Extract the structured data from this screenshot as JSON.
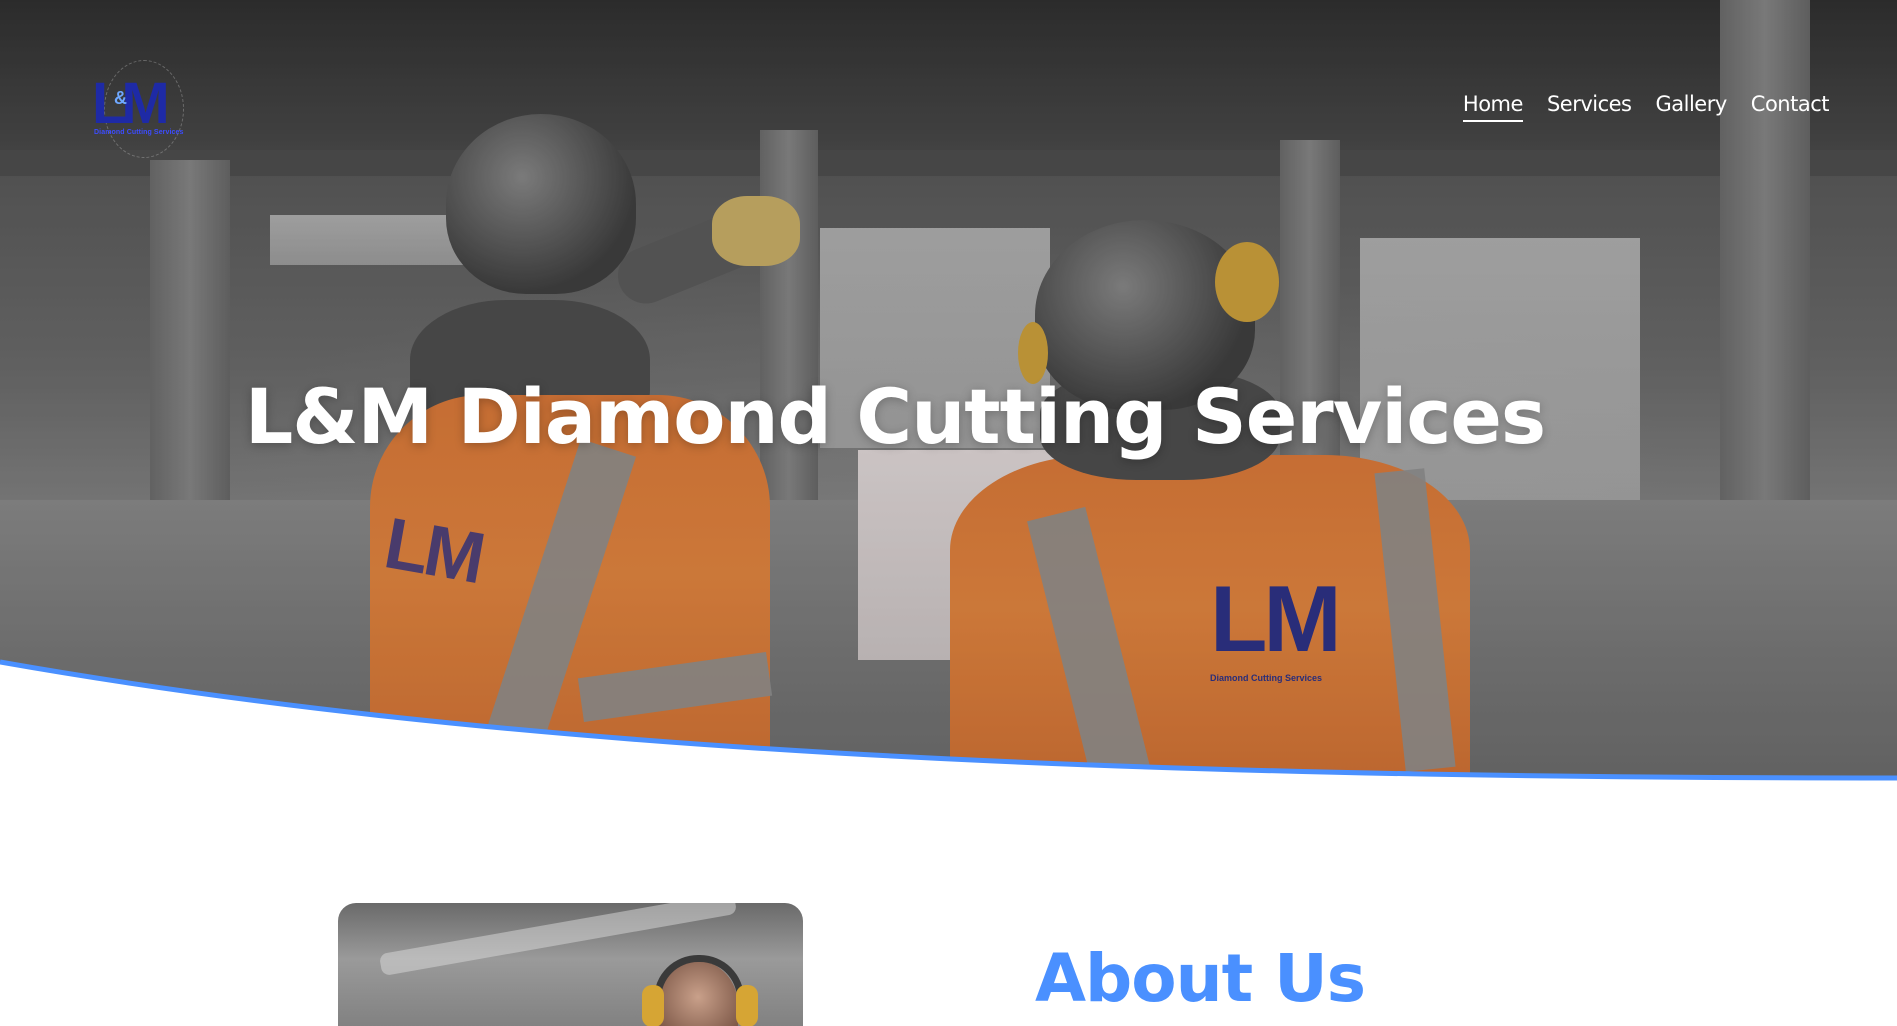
{
  "brand": {
    "logo_letters": "LM",
    "logo_amp": "&",
    "logo_tagline": "Diamond Cutting Services"
  },
  "nav": {
    "items": [
      {
        "label": "Home",
        "active": true
      },
      {
        "label": "Services",
        "active": false
      },
      {
        "label": "Gallery",
        "active": false
      },
      {
        "label": "Contact",
        "active": false
      }
    ]
  },
  "hero": {
    "title": "L&M Diamond Cutting Services"
  },
  "about": {
    "title": "About Us"
  },
  "colors": {
    "accent": "#4a90ff",
    "logo_blue": "#1e2aa6",
    "nav_text": "#ffffff"
  }
}
